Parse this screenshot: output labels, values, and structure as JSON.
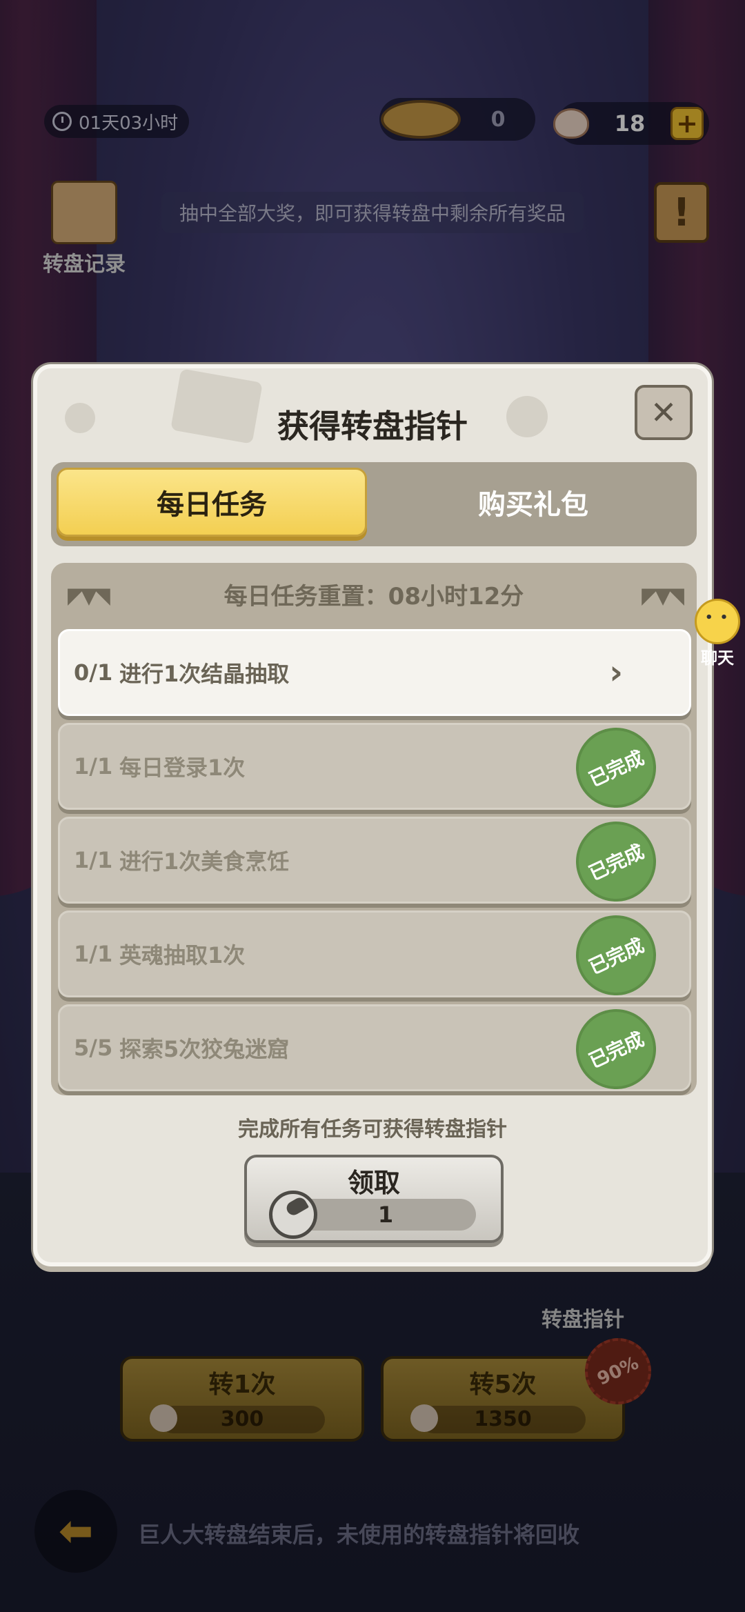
{
  "top_bar": {
    "timer": "01天03小时",
    "pointer_count": "0",
    "shell_count": "18",
    "plus_label": "+"
  },
  "record_label": "转盘记录",
  "notice": "抽中全部大奖，即可获得转盘中剩余所有奖品",
  "info_label": "!",
  "dialog": {
    "title": "获得转盘指针",
    "close_label": "✕",
    "tabs": [
      {
        "label": "每日任务",
        "active": true
      },
      {
        "label": "购买礼包",
        "active": false
      }
    ],
    "reset_text": "每日任务重置：08小时12分",
    "tasks": [
      {
        "progress": "0/1",
        "name": "进行1次结晶抽取",
        "status": "arrow",
        "arrow": "›"
      },
      {
        "progress": "1/1",
        "name": "每日登录1次",
        "status": "已完成"
      },
      {
        "progress": "1/1",
        "name": "进行1次美食烹饪",
        "status": "已完成"
      },
      {
        "progress": "1/1",
        "name": "英魂抽取1次",
        "status": "已完成"
      },
      {
        "progress": "5/5",
        "name": "探索5次狡兔迷窟",
        "status": "已完成"
      }
    ],
    "footer_tip": "完成所有任务可获得转盘指针",
    "claim": {
      "label": "领取",
      "quantity": "1"
    }
  },
  "chat_label": "聊天",
  "game": {
    "pointer_label": "转盘指针",
    "spin_once": {
      "label": "转1次",
      "cost": "300"
    },
    "spin_five": {
      "label": "转5次",
      "cost": "1350"
    },
    "discount": "90%",
    "back_arrow": "⬅",
    "bottom_tip": "巨人大转盘结束后，未使用的转盘指针将回收"
  },
  "colors": {
    "tab_active": "#f3cf52",
    "stamp_green": "#6aa053",
    "panel": "#e7e4dc"
  }
}
